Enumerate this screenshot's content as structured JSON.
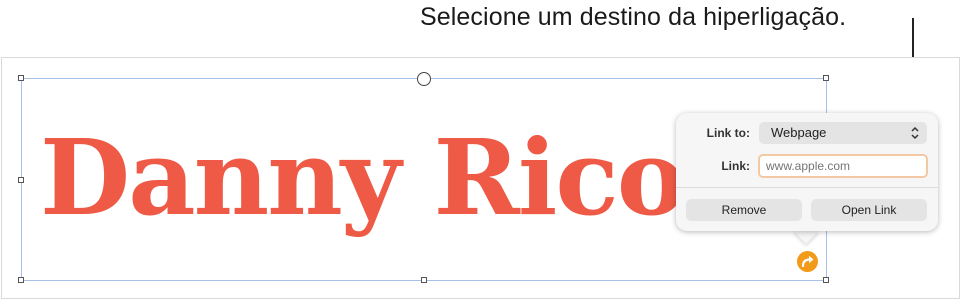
{
  "callout": {
    "text": "Selecione um destino da hiperligação."
  },
  "canvas": {
    "text": "Danny Rico"
  },
  "popover": {
    "link_to_label": "Link to:",
    "link_to_value": "Webpage",
    "link_label": "Link:",
    "link_placeholder": "www.apple.com",
    "remove_label": "Remove",
    "open_link_label": "Open Link"
  },
  "icons": {
    "select": "chevron-up-down-icon",
    "badge": "hyperlink-arrow-icon"
  },
  "colors": {
    "title": "#ee5a46",
    "badge": "#f29a1a",
    "input_focus": "#f3c9a3",
    "selection": "#a8c1ea"
  }
}
